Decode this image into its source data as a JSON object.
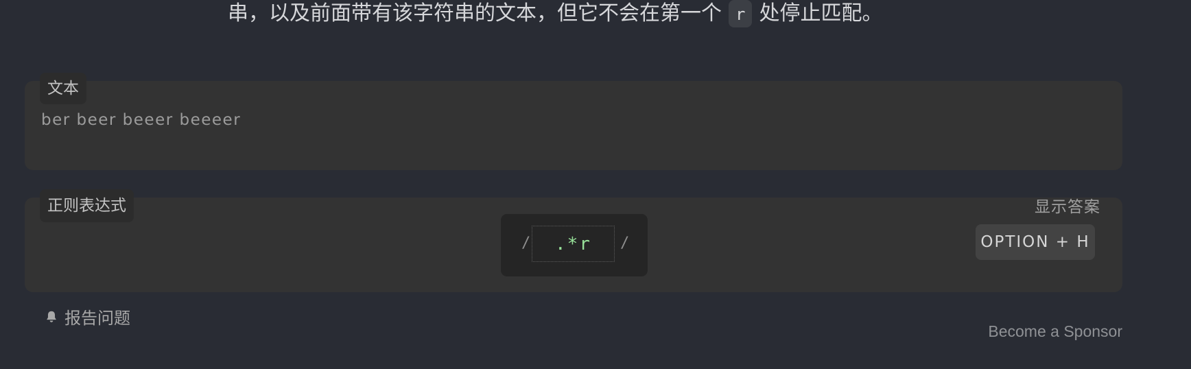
{
  "intro": {
    "text_before": "串，以及前面带有该字符串的文本，但它不会在第一个",
    "code": "r",
    "text_after": "处停止匹配。"
  },
  "text_panel": {
    "label": "文本",
    "content": "ber beer beeer beeeer"
  },
  "regex_panel": {
    "label": "正则表达式",
    "slash_left": "/",
    "slash_right": "/",
    "value": ".*r",
    "show_answer": "显示答案",
    "shortcut": "OPTION + H"
  },
  "footer": {
    "report_label": "报告问题",
    "report_icon": "bell-icon",
    "sponsor_label": "Become a Sponsor"
  },
  "colors": {
    "background": "#292c34",
    "panel": "#333333",
    "regex_text": "#98e29a"
  }
}
